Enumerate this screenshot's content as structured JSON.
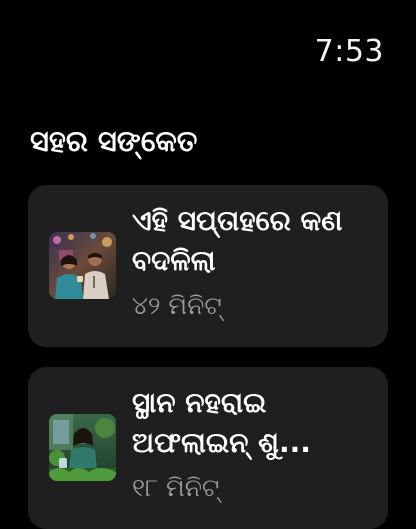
{
  "status_bar": {
    "time": "7:53"
  },
  "section": {
    "title": "ସହର ସଙ୍କେତ"
  },
  "episodes": [
    {
      "title": "ଏହି ସପ୍ତାହରେ କଣ ବଦଳିଲା",
      "duration": "୪୨ ମିନିଟ୍",
      "thumbnail": "couple-city-night-thumbnail"
    },
    {
      "title": "ସ୍ଥାନ ନହରାଇ ଅଫଲାଇନ୍ ଶୁ...",
      "duration": "୧୮ ମିନିଟ୍",
      "thumbnail": "woman-garden-thumbnail"
    }
  ]
}
